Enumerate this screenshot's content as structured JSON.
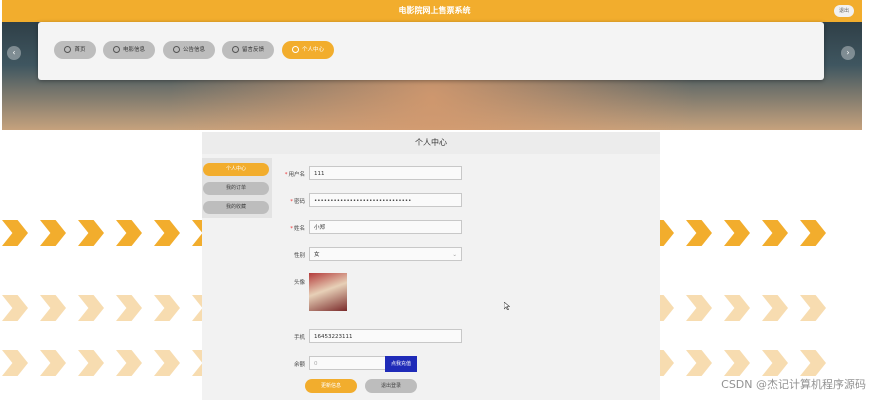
{
  "header": {
    "title": "电影院网上售票系统",
    "logout_label": "退出"
  },
  "nav": {
    "items": [
      {
        "label": "首页",
        "icon": "home-icon"
      },
      {
        "label": "电影信息",
        "icon": "film-icon"
      },
      {
        "label": "公告信息",
        "icon": "notice-icon"
      },
      {
        "label": "留言反馈",
        "icon": "message-icon"
      },
      {
        "label": "个人中心",
        "icon": "user-icon",
        "active": true
      }
    ]
  },
  "banner": {
    "prev_glyph": "‹",
    "next_glyph": "›"
  },
  "panel": {
    "title": "个人中心"
  },
  "sidebar": {
    "items": [
      {
        "label": "个人中心",
        "active": true
      },
      {
        "label": "我的订单"
      },
      {
        "label": "我的收藏"
      }
    ]
  },
  "form": {
    "username": {
      "label": "用户名",
      "value": "111"
    },
    "password": {
      "label": "密码",
      "value": "••••••••••••••••••••••••••••••"
    },
    "name": {
      "label": "姓名",
      "value": "小郑"
    },
    "gender": {
      "label": "性别",
      "value": "女"
    },
    "avatar": {
      "label": "头像"
    },
    "phone": {
      "label": "手机",
      "value": "16453223111"
    },
    "balance": {
      "label": "余额",
      "placeholder": "0",
      "upload_label": "点我充值"
    }
  },
  "buttons": {
    "update": "更新信息",
    "exit": "退出登录"
  },
  "watermark": "CSDN @杰记计算机程序源码",
  "colors": {
    "accent": "#f2ad2d",
    "accent_light": "#f7dcb0",
    "upload": "#1f2bb8"
  }
}
